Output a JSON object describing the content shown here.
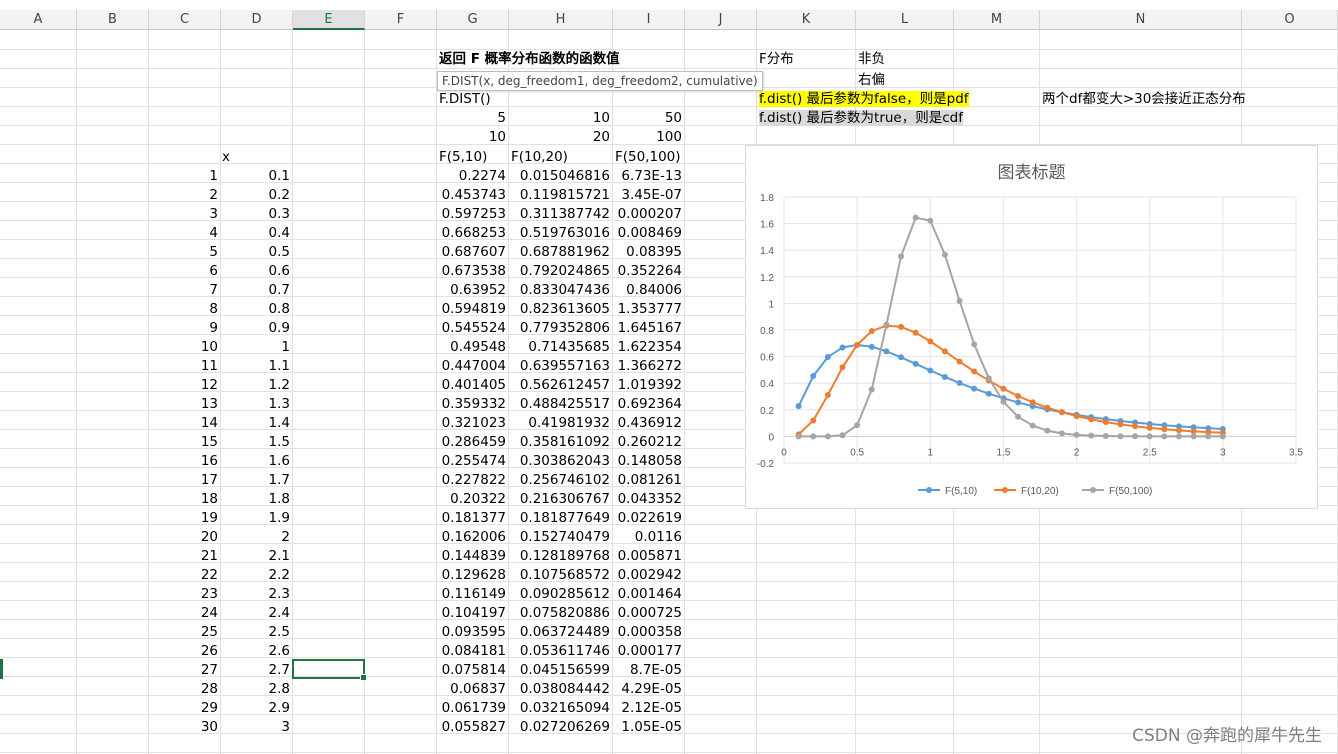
{
  "columns": [
    "A",
    "B",
    "C",
    "D",
    "E",
    "F",
    "G",
    "H",
    "I",
    "J",
    "K",
    "L",
    "M",
    "N",
    "O"
  ],
  "selected_column": "E",
  "title_cell": "返回 F 概率分布函数的函数值",
  "tooltip": "F.DIST(x, deg_freedom1, deg_freedom2, cumulative)",
  "fdist_label": "F.DIST()",
  "df1": [
    "5",
    "10",
    "50"
  ],
  "df2": [
    "10",
    "20",
    "100"
  ],
  "x_header": "x",
  "series_headers": [
    "F(5,10)",
    "F(10,20)",
    "F(50,100)"
  ],
  "notes": {
    "k1": "F分布",
    "l1": "非负",
    "l2": "右偏",
    "k3": "f.dist()  最后参数为false，则是pdf",
    "k4": "f.dist()  最后参数为true，则是cdf",
    "n3": "两个df都变大>30会接近正态分布"
  },
  "rows": [
    {
      "i": "1",
      "x": "0.1",
      "a": "0.2274",
      "b": "0.015046816",
      "c": "6.73E-13"
    },
    {
      "i": "2",
      "x": "0.2",
      "a": "0.453743",
      "b": "0.119815721",
      "c": "3.45E-07"
    },
    {
      "i": "3",
      "x": "0.3",
      "a": "0.597253",
      "b": "0.311387742",
      "c": "0.000207"
    },
    {
      "i": "4",
      "x": "0.4",
      "a": "0.668253",
      "b": "0.519763016",
      "c": "0.008469"
    },
    {
      "i": "5",
      "x": "0.5",
      "a": "0.687607",
      "b": "0.687881962",
      "c": "0.08395"
    },
    {
      "i": "6",
      "x": "0.6",
      "a": "0.673538",
      "b": "0.792024865",
      "c": "0.352264"
    },
    {
      "i": "7",
      "x": "0.7",
      "a": "0.63952",
      "b": "0.833047436",
      "c": "0.84006"
    },
    {
      "i": "8",
      "x": "0.8",
      "a": "0.594819",
      "b": "0.823613605",
      "c": "1.353777"
    },
    {
      "i": "9",
      "x": "0.9",
      "a": "0.545524",
      "b": "0.779352806",
      "c": "1.645167"
    },
    {
      "i": "10",
      "x": "1",
      "a": "0.49548",
      "b": "0.71435685",
      "c": "1.622354"
    },
    {
      "i": "11",
      "x": "1.1",
      "a": "0.447004",
      "b": "0.639557163",
      "c": "1.366272"
    },
    {
      "i": "12",
      "x": "1.2",
      "a": "0.401405",
      "b": "0.562612457",
      "c": "1.019392"
    },
    {
      "i": "13",
      "x": "1.3",
      "a": "0.359332",
      "b": "0.488425517",
      "c": "0.692364"
    },
    {
      "i": "14",
      "x": "1.4",
      "a": "0.321023",
      "b": "0.41981932",
      "c": "0.436912"
    },
    {
      "i": "15",
      "x": "1.5",
      "a": "0.286459",
      "b": "0.358161092",
      "c": "0.260212"
    },
    {
      "i": "16",
      "x": "1.6",
      "a": "0.255474",
      "b": "0.303862043",
      "c": "0.148058"
    },
    {
      "i": "17",
      "x": "1.7",
      "a": "0.227822",
      "b": "0.256746102",
      "c": "0.081261"
    },
    {
      "i": "18",
      "x": "1.8",
      "a": "0.20322",
      "b": "0.216306767",
      "c": "0.043352"
    },
    {
      "i": "19",
      "x": "1.9",
      "a": "0.181377",
      "b": "0.181877649",
      "c": "0.022619"
    },
    {
      "i": "20",
      "x": "2",
      "a": "0.162006",
      "b": "0.152740479",
      "c": "0.0116"
    },
    {
      "i": "21",
      "x": "2.1",
      "a": "0.144839",
      "b": "0.128189768",
      "c": "0.005871"
    },
    {
      "i": "22",
      "x": "2.2",
      "a": "0.129628",
      "b": "0.107568572",
      "c": "0.002942"
    },
    {
      "i": "23",
      "x": "2.3",
      "a": "0.116149",
      "b": "0.090285612",
      "c": "0.001464"
    },
    {
      "i": "24",
      "x": "2.4",
      "a": "0.104197",
      "b": "0.075820886",
      "c": "0.000725"
    },
    {
      "i": "25",
      "x": "2.5",
      "a": "0.093595",
      "b": "0.063724489",
      "c": "0.000358"
    },
    {
      "i": "26",
      "x": "2.6",
      "a": "0.084181",
      "b": "0.053611746",
      "c": "0.000177"
    },
    {
      "i": "27",
      "x": "2.7",
      "a": "0.075814",
      "b": "0.045156599",
      "c": "8.7E-05"
    },
    {
      "i": "28",
      "x": "2.8",
      "a": "0.06837",
      "b": "0.038084442",
      "c": "4.29E-05"
    },
    {
      "i": "29",
      "x": "2.9",
      "a": "0.061739",
      "b": "0.032165094",
      "c": "2.12E-05"
    },
    {
      "i": "30",
      "x": "3",
      "a": "0.055827",
      "b": "0.027206269",
      "c": "1.05E-05"
    }
  ],
  "chart_data": {
    "type": "line",
    "title": "图表标题",
    "xlim": [
      0,
      3.5
    ],
    "ylim": [
      -0.2,
      1.8
    ],
    "xticks": [
      "0",
      "0.5",
      "1",
      "1.5",
      "2",
      "2.5",
      "3",
      "3.5"
    ],
    "yticks": [
      "-0.2",
      "0",
      "0.2",
      "0.4",
      "0.6",
      "0.8",
      "1",
      "1.2",
      "1.4",
      "1.6",
      "1.8"
    ],
    "grid": true,
    "legend": "bottom",
    "x": [
      0.1,
      0.2,
      0.3,
      0.4,
      0.5,
      0.6,
      0.7,
      0.8,
      0.9,
      1,
      1.1,
      1.2,
      1.3,
      1.4,
      1.5,
      1.6,
      1.7,
      1.8,
      1.9,
      2,
      2.1,
      2.2,
      2.3,
      2.4,
      2.5,
      2.6,
      2.7,
      2.8,
      2.9,
      3
    ],
    "series": [
      {
        "name": "F(5,10)",
        "color": "#5b9bd5",
        "values": [
          0.2274,
          0.453743,
          0.597253,
          0.668253,
          0.687607,
          0.673538,
          0.63952,
          0.594819,
          0.545524,
          0.49548,
          0.447004,
          0.401405,
          0.359332,
          0.321023,
          0.286459,
          0.255474,
          0.227822,
          0.20322,
          0.181377,
          0.162006,
          0.144839,
          0.129628,
          0.116149,
          0.104197,
          0.093595,
          0.084181,
          0.075814,
          0.06837,
          0.061739,
          0.055827
        ]
      },
      {
        "name": "F(10,20)",
        "color": "#ed7d31",
        "values": [
          0.015046816,
          0.119815721,
          0.311387742,
          0.519763016,
          0.687881962,
          0.792024865,
          0.833047436,
          0.823613605,
          0.779352806,
          0.71435685,
          0.639557163,
          0.562612457,
          0.488425517,
          0.41981932,
          0.358161092,
          0.303862043,
          0.256746102,
          0.216306767,
          0.181877649,
          0.152740479,
          0.128189768,
          0.107568572,
          0.090285612,
          0.075820886,
          0.063724489,
          0.053611746,
          0.045156599,
          0.038084442,
          0.032165094,
          0.027206269
        ]
      },
      {
        "name": "F(50,100)",
        "color": "#a5a5a5",
        "values": [
          6.73e-13,
          3.45e-07,
          0.000207,
          0.008469,
          0.08395,
          0.352264,
          0.84006,
          1.353777,
          1.645167,
          1.622354,
          1.366272,
          1.019392,
          0.692364,
          0.436912,
          0.260212,
          0.148058,
          0.081261,
          0.043352,
          0.022619,
          0.0116,
          0.005871,
          0.002942,
          0.001464,
          0.000725,
          0.000358,
          0.000177,
          8.7e-05,
          4.29e-05,
          2.12e-05,
          1.05e-05
        ]
      }
    ]
  },
  "watermark": "CSDN @奔跑的犀牛先生"
}
